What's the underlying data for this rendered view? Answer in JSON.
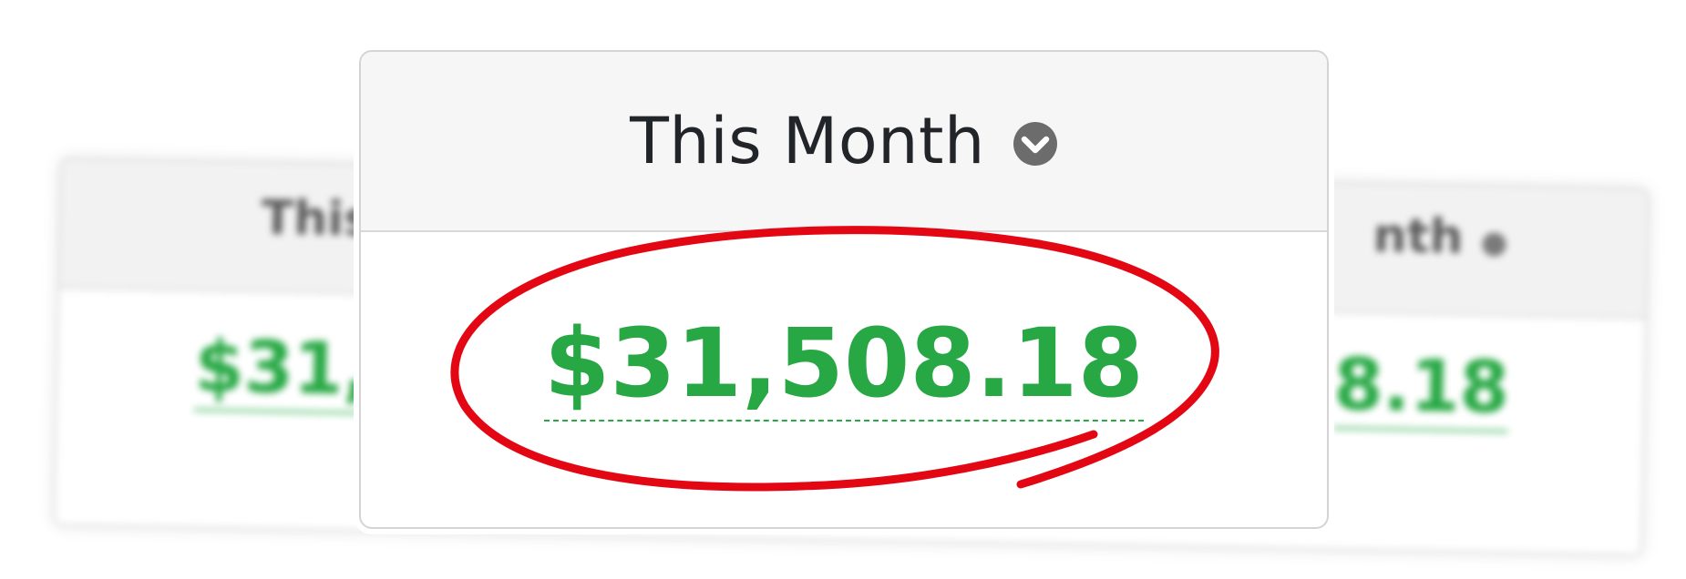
{
  "background_cards": {
    "left": {
      "title": "This",
      "amount": "$31,"
    },
    "right": {
      "title": "nth",
      "amount": "8.18"
    }
  },
  "card": {
    "period_label": "This Month",
    "amount": "$31,508.18",
    "dropdown_icon": "chevron-down-circle-icon"
  },
  "annotation": {
    "type": "red-hand-drawn-circle",
    "color": "#e30613"
  },
  "colors": {
    "amount": "#28a745",
    "header_bg": "#f6f6f6",
    "title_text": "#212529",
    "icon": "#6c6c6c"
  }
}
